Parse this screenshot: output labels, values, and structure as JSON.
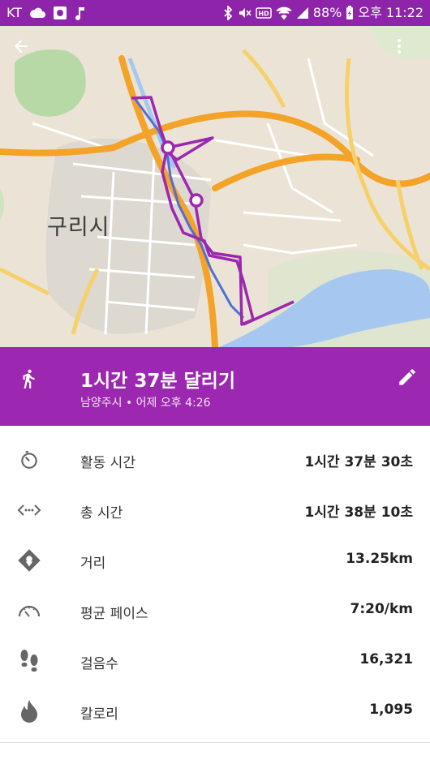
{
  "statusbar": {
    "carrier": "KT",
    "battery": "88%",
    "time": "오후 11:22"
  },
  "map": {
    "city_label": "구리시"
  },
  "activity": {
    "title": "1시간 37분 달리기",
    "subtitle": "남양주시 • 어제 오후 4:26"
  },
  "stats": [
    {
      "icon": "timer-icon",
      "label": "활동 시간",
      "value": "1시간 37분 30초"
    },
    {
      "icon": "total-time-icon",
      "label": "총 시간",
      "value": "1시간 38분 10초"
    },
    {
      "icon": "distance-icon",
      "label": "거리",
      "value": "13.25km"
    },
    {
      "icon": "pace-icon",
      "label": "평균 페이스",
      "value": "7:20/km"
    },
    {
      "icon": "footsteps-icon",
      "label": "걸음수",
      "value": "16,321"
    },
    {
      "icon": "flame-icon",
      "label": "칼로리",
      "value": "1,095"
    }
  ],
  "colors": {
    "accent": "#9c27b0",
    "statusbar": "#8e24aa"
  }
}
